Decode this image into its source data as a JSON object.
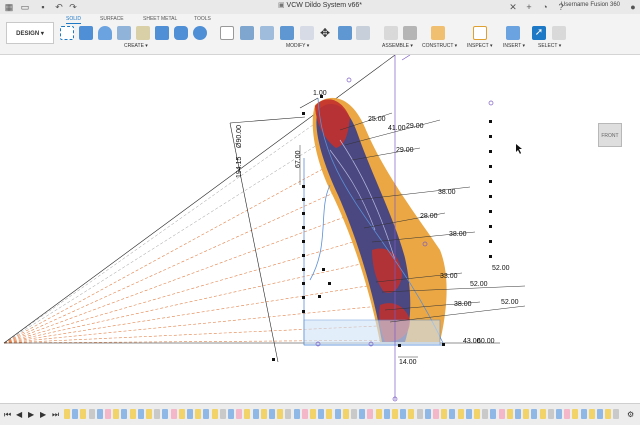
{
  "app": {
    "document_title": "VCW Dildo System v66*",
    "user": "Username Fusion 360"
  },
  "toolbar": {
    "workspace": "DESIGN ▾",
    "tabs": [
      "SOLID",
      "SURFACE",
      "SHEET METAL",
      "TOOLS"
    ],
    "groups": [
      "CREATE ▾",
      "MODIFY ▾",
      "ASSEMBLE ▾",
      "CONSTRUCT ▾",
      "INSPECT ▾",
      "INSERT ▾",
      "SELECT ▾"
    ]
  },
  "viewcube": {
    "face": "FRONT"
  },
  "canvas": {
    "dimensions": [
      "1.00",
      "25.00",
      "41.00",
      "29.00",
      "29.00",
      "Ø90.00",
      "194.15",
      "67.00",
      "38.00",
      "28.00",
      "38.00",
      "52.00",
      "33.00",
      "52.00",
      "38.00",
      "52.00",
      "43.00",
      "60.00",
      "14.00"
    ]
  },
  "colors": {
    "accent": "#1d78c5",
    "body_orange": "#e9a23a",
    "body_purple": "#3d3f86",
    "body_red": "#c3302c",
    "sketch_blue": "#5b8fd8",
    "construction_orange": "#e2824a"
  }
}
